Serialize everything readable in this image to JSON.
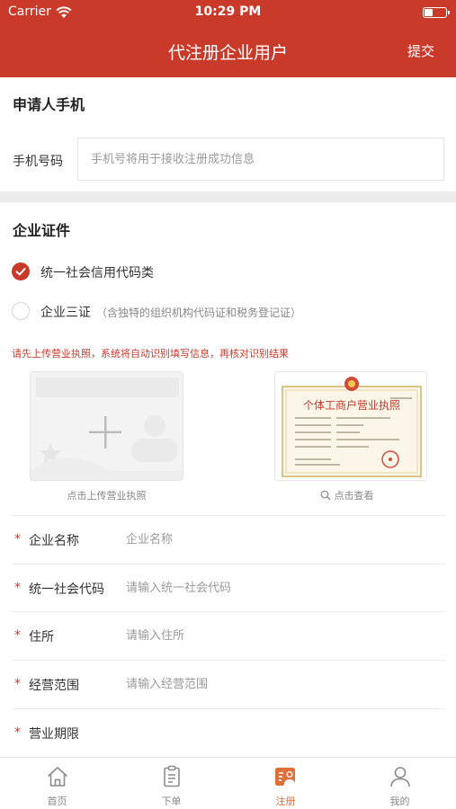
{
  "status_bar": {
    "carrier": "Carrier",
    "time": "10:29 PM",
    "battery_level": 0.4
  },
  "nav": {
    "title": "代注册企业用户",
    "submit_label": "提交"
  },
  "applicant": {
    "section_title": "申请人手机",
    "phone_label": "手机号码",
    "phone_placeholder": "手机号将用于接收注册成功信息",
    "phone_value": ""
  },
  "certificate": {
    "section_title": "企业证件",
    "options": [
      {
        "label": "统一社会信用代码类",
        "note": "",
        "checked": true
      },
      {
        "label": "企业三证",
        "note": "（含独特的组织机构代码证和税务登记证）",
        "checked": false
      }
    ],
    "notice": "请先上传营业执照，系统将自动识别填写信息，再核对识别结果",
    "upload_caption": "点击上传营业执照",
    "sample_caption": "点击查看",
    "sample_title": "个体工商户营业执照"
  },
  "form_fields": [
    {
      "label": "企业名称",
      "placeholder": "企业名称",
      "value": "",
      "required": true
    },
    {
      "label": "统一社会代码",
      "placeholder": "请输入统一社会代码",
      "value": "",
      "required": true
    },
    {
      "label": "住所",
      "placeholder": "请输入住所",
      "value": "",
      "required": true
    },
    {
      "label": "经营范围",
      "placeholder": "请输入经营范围",
      "value": "",
      "required": true
    },
    {
      "label": "营业期限",
      "placeholder": "",
      "value": "",
      "required": true
    }
  ],
  "tabs": [
    {
      "label": "首页",
      "icon": "home-icon",
      "active": false
    },
    {
      "label": "下单",
      "icon": "order-icon",
      "active": false
    },
    {
      "label": "注册",
      "icon": "register-icon",
      "active": true
    },
    {
      "label": "我的",
      "icon": "user-icon",
      "active": false
    }
  ],
  "colors": {
    "brand_red": "#c93a2b",
    "tab_active": "#e0703a",
    "text_gray": "#888888",
    "divider": "#ececec"
  }
}
